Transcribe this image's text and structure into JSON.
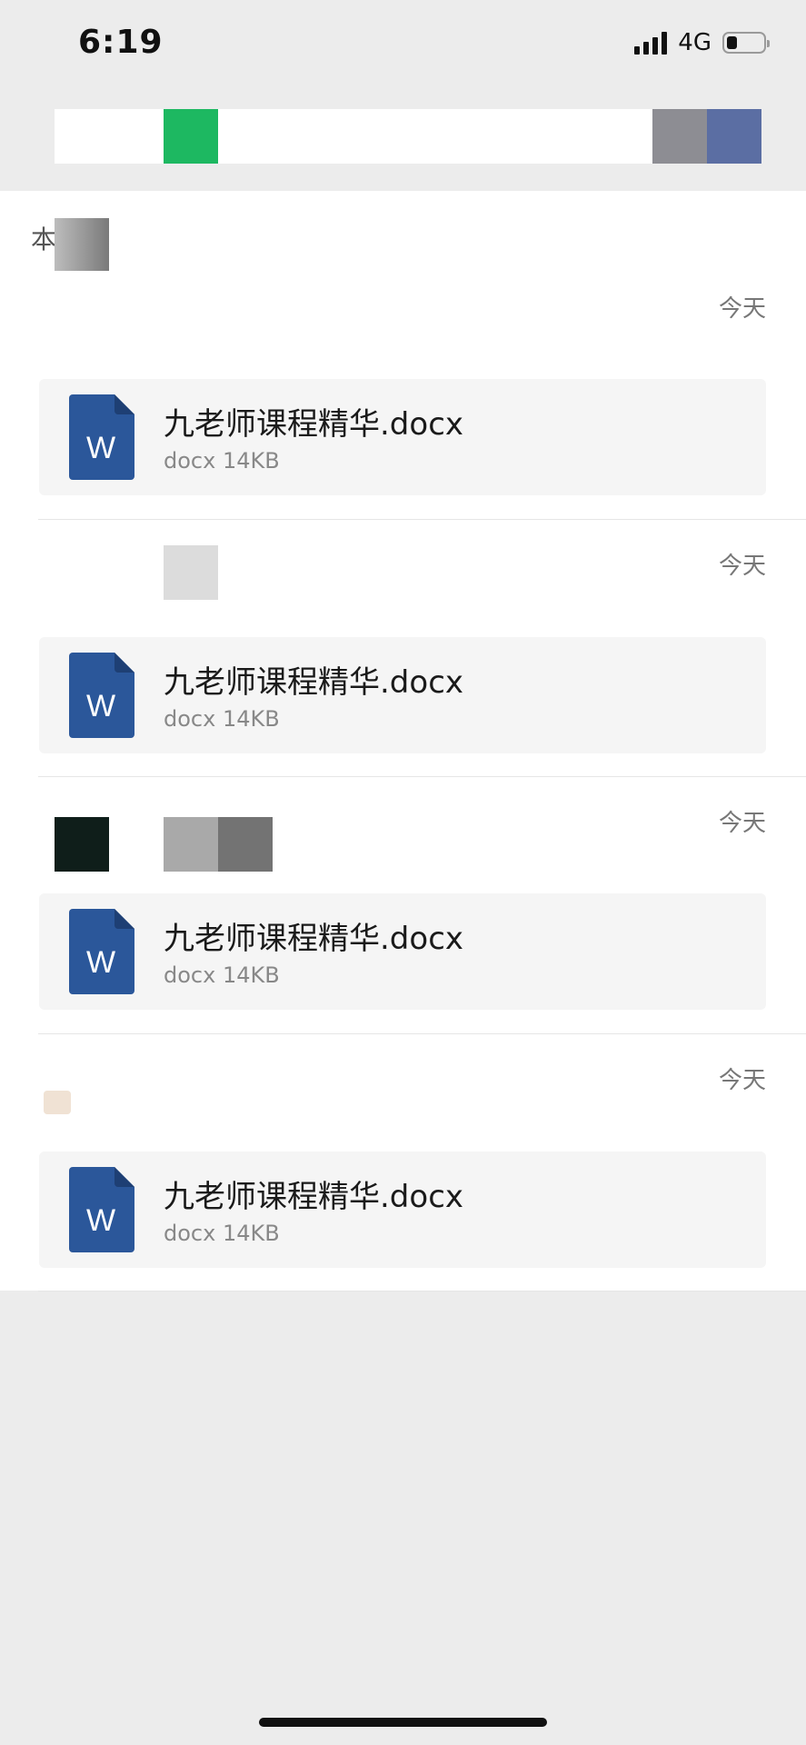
{
  "status_bar": {
    "time": "6:19",
    "network": "4G",
    "battery_level": 0.3
  },
  "section": {
    "label": "本周"
  },
  "groups": [
    {
      "date": "今天",
      "file": {
        "name": "九老师课程精华.docx",
        "meta": "docx 14KB",
        "icon": "word-doc-icon",
        "icon_letter": "W"
      }
    },
    {
      "date": "今天",
      "file": {
        "name": "九老师课程精华.docx",
        "meta": "docx 14KB",
        "icon": "word-doc-icon",
        "icon_letter": "W"
      }
    },
    {
      "date": "今天",
      "file": {
        "name": "九老师课程精华.docx",
        "meta": "docx 14KB",
        "icon": "word-doc-icon",
        "icon_letter": "W"
      }
    },
    {
      "date": "今天",
      "file": {
        "name": "九老师课程精华.docx",
        "meta": "docx 14KB",
        "icon": "word-doc-icon",
        "icon_letter": "W"
      }
    }
  ],
  "colors": {
    "word_blue": "#2b579a",
    "word_fold": "#1e3f74",
    "card_bg": "#f5f5f5",
    "page_bg": "#ececec"
  }
}
